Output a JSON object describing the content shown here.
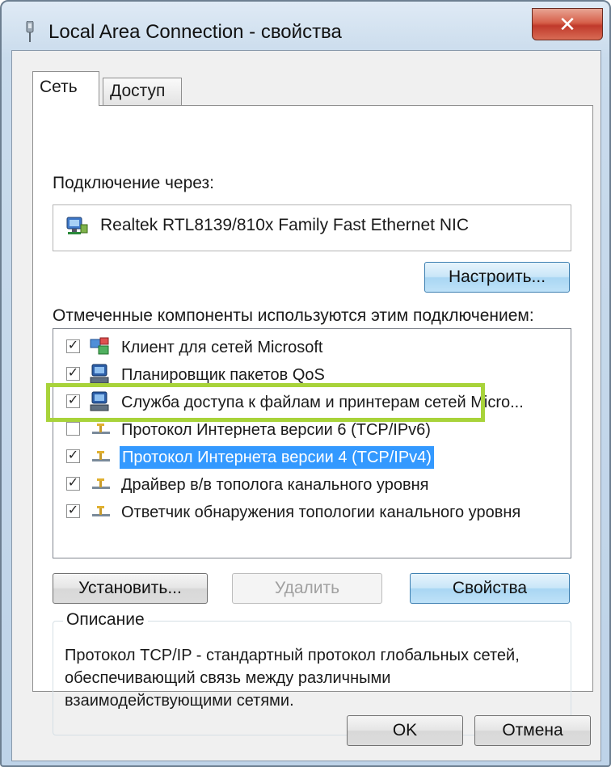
{
  "window": {
    "title": "Local Area Connection - свойства",
    "close_symbol": "✕"
  },
  "tabs": [
    {
      "label": "Сеть",
      "active": true
    },
    {
      "label": "Доступ",
      "active": false
    }
  ],
  "connection": {
    "label": "Подключение через:",
    "adapter_name": "Realtek RTL8139/810x Family Fast Ethernet NIC",
    "adapter_icon": "network-adapter-icon",
    "configure_label": "Настроить..."
  },
  "components": {
    "label": "Отмеченные компоненты используются этим подключением:",
    "items": [
      {
        "label": "Клиент для сетей Microsoft",
        "checked": true,
        "icon": "network-client-icon",
        "selected": false
      },
      {
        "label": "Планировщик пакетов QoS",
        "checked": true,
        "icon": "computer-service-icon",
        "selected": false
      },
      {
        "label": "Служба доступа к файлам и принтерам сетей Micro...",
        "checked": true,
        "icon": "computer-service-icon",
        "selected": false
      },
      {
        "label": "Протокол Интернета версии 6 (TCP/IPv6)",
        "checked": false,
        "icon": "protocol-icon",
        "selected": false
      },
      {
        "label": "Протокол Интернета версии 4 (TCP/IPv4)",
        "checked": true,
        "icon": "protocol-icon",
        "selected": true
      },
      {
        "label": "Драйвер в/в тополога канального уровня",
        "checked": true,
        "icon": "protocol-icon",
        "selected": false
      },
      {
        "label": "Ответчик обнаружения топологии канального уровня",
        "checked": true,
        "icon": "protocol-icon",
        "selected": false
      }
    ]
  },
  "actions": {
    "install_label": "Установить...",
    "remove_label": "Удалить",
    "properties_label": "Свойства"
  },
  "description": {
    "title": "Описание",
    "text": "Протокол TCP/IP - стандартный протокол глобальных сетей, обеспечивающий связь между различными взаимодействующими сетями."
  },
  "footer": {
    "ok_label": "OK",
    "cancel_label": "Отмена"
  },
  "colors": {
    "selection": "#3399ff",
    "highlight_frame": "#a8d33a",
    "close_button": "#c0392b"
  }
}
